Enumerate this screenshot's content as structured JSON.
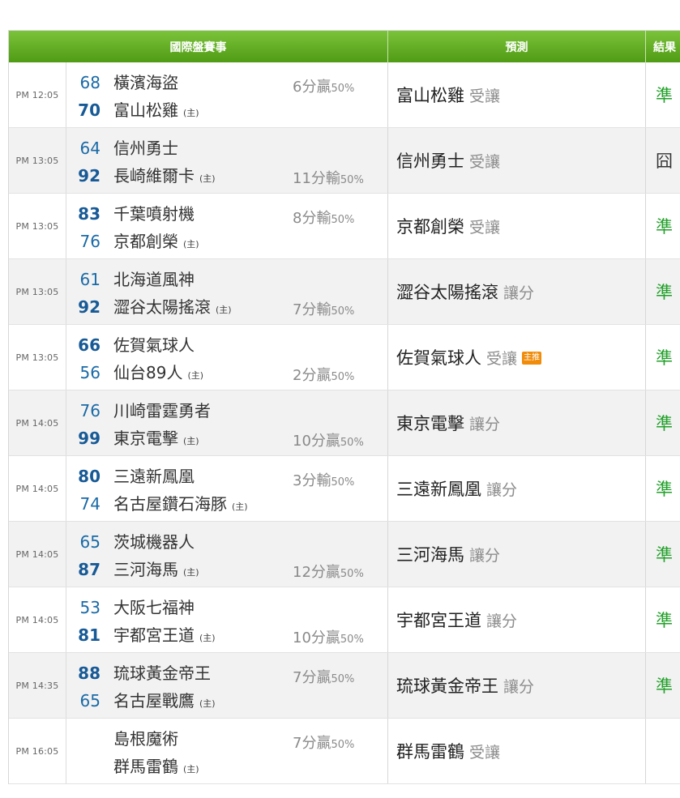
{
  "header": {
    "col_match": "國際盤賽事",
    "col_prediction": "預測",
    "col_result": "結果"
  },
  "games": [
    {
      "time": "PM 12:05",
      "away": {
        "name": "橫濱海盜",
        "score": "68"
      },
      "home": {
        "name": "富山松雞",
        "score": "70"
      },
      "home_mark": "(主)",
      "spread": "6分贏",
      "pct": "50%",
      "spread_pos": "top",
      "winner": "home",
      "pick": "富山松雞",
      "pick_type": "受讓",
      "badge": "",
      "result": "準",
      "result_kind": "hit"
    },
    {
      "time": "PM 13:05",
      "away": {
        "name": "信州勇士",
        "score": "64"
      },
      "home": {
        "name": "長崎維爾卡",
        "score": "92"
      },
      "home_mark": "(主)",
      "spread": "11分輸",
      "pct": "50%",
      "spread_pos": "bottom",
      "winner": "home",
      "pick": "信州勇士",
      "pick_type": "受讓",
      "badge": "",
      "result": "囧",
      "result_kind": "miss"
    },
    {
      "time": "PM 13:05",
      "away": {
        "name": "千葉噴射機",
        "score": "83"
      },
      "home": {
        "name": "京都創榮",
        "score": "76"
      },
      "home_mark": "(主)",
      "spread": "8分輸",
      "pct": "50%",
      "spread_pos": "top",
      "winner": "away",
      "pick": "京都創榮",
      "pick_type": "受讓",
      "badge": "",
      "result": "準",
      "result_kind": "hit"
    },
    {
      "time": "PM 13:05",
      "away": {
        "name": "北海道風神",
        "score": "61"
      },
      "home": {
        "name": "澀谷太陽搖滾",
        "score": "92"
      },
      "home_mark": "(主)",
      "spread": "7分輸",
      "pct": "50%",
      "spread_pos": "bottom",
      "winner": "home",
      "pick": "澀谷太陽搖滾",
      "pick_type": "讓分",
      "badge": "",
      "result": "準",
      "result_kind": "hit"
    },
    {
      "time": "PM 13:05",
      "away": {
        "name": "佐賀氣球人",
        "score": "66"
      },
      "home": {
        "name": "仙台89人",
        "score": "56"
      },
      "home_mark": "(主)",
      "spread": "2分贏",
      "pct": "50%",
      "spread_pos": "bottom",
      "winner": "away",
      "pick": "佐賀氣球人",
      "pick_type": "受讓",
      "badge": "主推",
      "result": "準",
      "result_kind": "hit"
    },
    {
      "time": "PM 14:05",
      "away": {
        "name": "川崎雷霆勇者",
        "score": "76"
      },
      "home": {
        "name": "東京電擊",
        "score": "99"
      },
      "home_mark": "(主)",
      "spread": "10分贏",
      "pct": "50%",
      "spread_pos": "bottom",
      "winner": "home",
      "pick": "東京電擊",
      "pick_type": "讓分",
      "badge": "",
      "result": "準",
      "result_kind": "hit"
    },
    {
      "time": "PM 14:05",
      "away": {
        "name": "三遠新鳳凰",
        "score": "80"
      },
      "home": {
        "name": "名古屋鑽石海豚",
        "score": "74"
      },
      "home_mark": "(主)",
      "spread": "3分輸",
      "pct": "50%",
      "spread_pos": "top",
      "winner": "away",
      "pick": "三遠新鳳凰",
      "pick_type": "讓分",
      "badge": "",
      "result": "準",
      "result_kind": "hit"
    },
    {
      "time": "PM 14:05",
      "away": {
        "name": "茨城機器人",
        "score": "65"
      },
      "home": {
        "name": "三河海馬",
        "score": "87"
      },
      "home_mark": "(主)",
      "spread": "12分贏",
      "pct": "50%",
      "spread_pos": "bottom",
      "winner": "home",
      "pick": "三河海馬",
      "pick_type": "讓分",
      "badge": "",
      "result": "準",
      "result_kind": "hit"
    },
    {
      "time": "PM 14:05",
      "away": {
        "name": "大阪七福神",
        "score": "53"
      },
      "home": {
        "name": "宇都宮王道",
        "score": "81"
      },
      "home_mark": "(主)",
      "spread": "10分贏",
      "pct": "50%",
      "spread_pos": "bottom",
      "winner": "home",
      "pick": "宇都宮王道",
      "pick_type": "讓分",
      "badge": "",
      "result": "準",
      "result_kind": "hit"
    },
    {
      "time": "PM 14:35",
      "away": {
        "name": "琉球黃金帝王",
        "score": "88"
      },
      "home": {
        "name": "名古屋戰鷹",
        "score": "65"
      },
      "home_mark": "(主)",
      "spread": "7分贏",
      "pct": "50%",
      "spread_pos": "top",
      "winner": "away",
      "pick": "琉球黃金帝王",
      "pick_type": "讓分",
      "badge": "",
      "result": "準",
      "result_kind": "hit"
    },
    {
      "time": "PM 16:05",
      "away": {
        "name": "島根魔術",
        "score": ""
      },
      "home": {
        "name": "群馬雷鶴",
        "score": ""
      },
      "home_mark": "(主)",
      "spread": "7分贏",
      "pct": "50%",
      "spread_pos": "top",
      "winner": "",
      "pick": "群馬雷鶴",
      "pick_type": "受讓",
      "badge": "",
      "result": "",
      "result_kind": "none"
    }
  ]
}
